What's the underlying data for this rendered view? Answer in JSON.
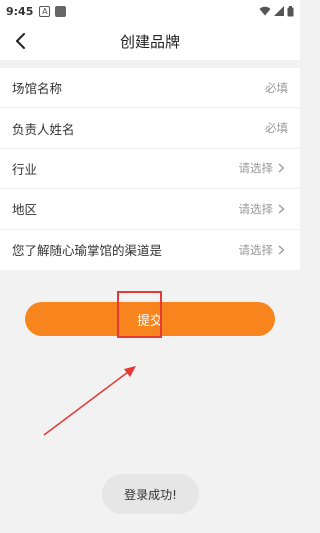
{
  "status_bar": {
    "time": "9:45",
    "a_icon_letter": "A"
  },
  "header": {
    "title": "创建品牌"
  },
  "form": {
    "fields": [
      {
        "label": "场馆名称",
        "value": "必填"
      },
      {
        "label": "负责人姓名",
        "value": "必填"
      },
      {
        "label": "行业",
        "value": "请选择"
      },
      {
        "label": "地区",
        "value": "请选择"
      },
      {
        "label": "您了解随心瑜掌馆的渠道是",
        "value": "请选择"
      }
    ]
  },
  "submit": {
    "label": "提交"
  },
  "toast": {
    "message": "登录成功!"
  },
  "colors": {
    "accent": "#f7841c",
    "annotation": "#e53935"
  }
}
